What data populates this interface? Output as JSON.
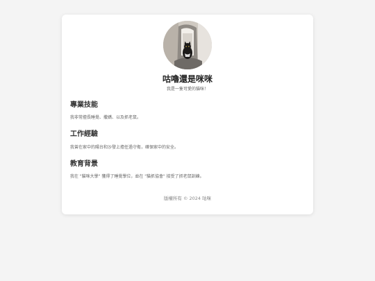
{
  "profile": {
    "name": "咕嚕還是咪咪",
    "tagline": "我是一隻可愛的貓咪！"
  },
  "sections": [
    {
      "title": "專業技能",
      "body": "我非常擅長睡覺、撒嬌、以及抓老鼠。"
    },
    {
      "title": "工作經驗",
      "body": "我曾在家中的陽台和沙發上擔任過守衛，確保家中的安全。"
    },
    {
      "title": "教育背景",
      "body": "我在 \"貓咪大學\" 獲得了睡覺學位，並在 \"貓抓協會\" 接受了抓老鼠訓練。"
    }
  ],
  "footer": {
    "text": "版權所有 © 2024 咕咪"
  }
}
